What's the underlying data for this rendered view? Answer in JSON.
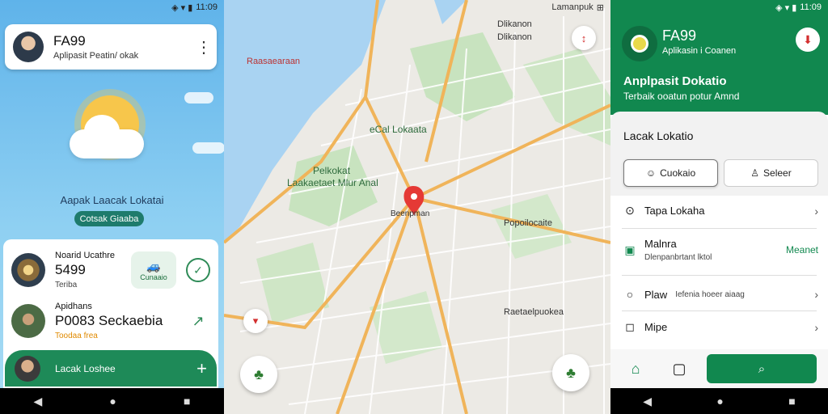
{
  "status": {
    "time": "11:09",
    "icons": "◈ ▾ ▮"
  },
  "panel1": {
    "card_title": "FA99",
    "card_subtitle": "Aplipasit Peatin/ okak",
    "menu_icon": "⋮",
    "hero_text": "Aapak Laacak Lokatai",
    "hero_pill": "Cotsak Giaaba",
    "row1": {
      "small": "Noarid Ucathre",
      "big": "5499",
      "mini": "Teriba",
      "button_label": "Cunaaio"
    },
    "row2": {
      "small": "Apidhans",
      "big": "P0083 Seckaebia",
      "mini": "Toodaa frea"
    },
    "bottom_label": "Lacak Loshee",
    "bottom_plus": "+"
  },
  "panel2": {
    "labels": {
      "top_name": "Dlikanon",
      "top_district": "Dlikanon",
      "top_right": "Lamanpuk",
      "top_right_badge": "⊞",
      "green_area": "eCal Lokaata",
      "center_left_1": "Pelkokat",
      "center_left_2": "Laakaetaet Mlur Anal",
      "pin_label": "Beenpman",
      "right_label": "Popoilocaite",
      "right_label_2": "Raetaelpuokea",
      "left_streets": "Raasaearaan"
    },
    "buttons": {
      "compass_icon": "▾",
      "tree_left": "♣",
      "tree_right": "♣"
    }
  },
  "panel3": {
    "title": "FA99",
    "subtitle": "Aplikasin i Coanen",
    "heading": "Anplpasit Dokatio",
    "subheading": "Terbaik ooatun potur Amnd",
    "section": "Lacak Lokatio",
    "seg1": "Cuokaio",
    "seg2": "Seleer",
    "list": [
      {
        "icon": "⊙",
        "label": "Tapa Lokaha",
        "trailing": "›"
      },
      {
        "icon": "▣",
        "label": "Malnra",
        "sub": "Dlenpanbrtant lktol",
        "trailing": "Meanet"
      },
      {
        "icon": "○",
        "label": "Plaw",
        "sub": "Iefenia hoeer aiaag",
        "trailing": "›"
      },
      {
        "icon": "◻",
        "label": "Mipe",
        "trailing": "›"
      }
    ],
    "bottom": {
      "home_icon": "⌂",
      "doc_icon": "▢",
      "search_icon": "⌕"
    }
  },
  "nav": {
    "back": "◀",
    "home": "●",
    "recent": "■"
  }
}
